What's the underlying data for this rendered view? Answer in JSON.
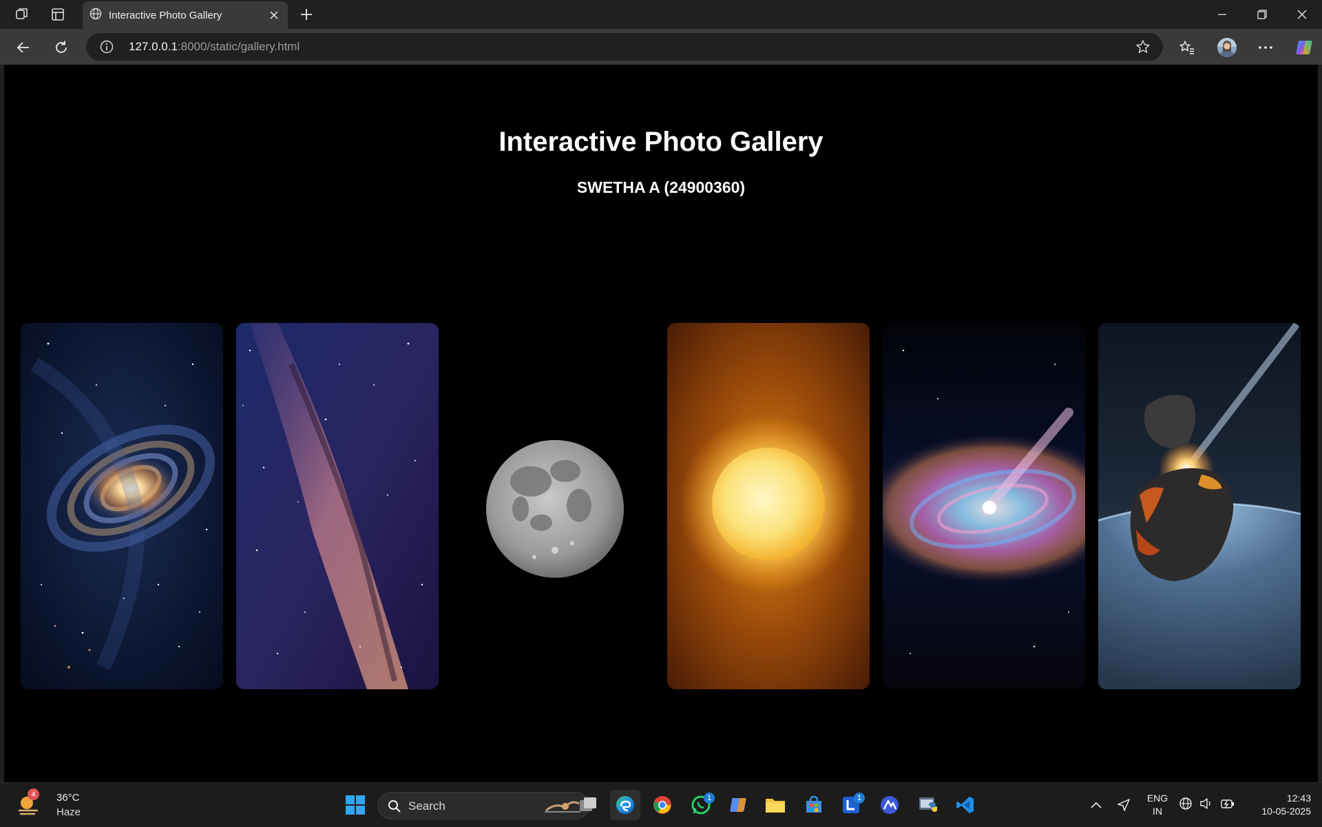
{
  "browser": {
    "tab_title": "Interactive Photo Gallery",
    "url_host": "127.0.0.1",
    "url_rest": ":8000/static/gallery.html"
  },
  "page": {
    "title": "Interactive Photo Gallery",
    "subtitle": "SWETHA A (24900360)",
    "images": [
      {
        "name": "spiral-galaxy-image"
      },
      {
        "name": "milky-way-image"
      },
      {
        "name": "moon-image"
      },
      {
        "name": "sun-image"
      },
      {
        "name": "galaxy-comet-image"
      },
      {
        "name": "asteroid-image"
      }
    ]
  },
  "taskbar": {
    "weather": {
      "temp": "36°C",
      "condition": "Haze",
      "badge": "4"
    },
    "search_label": "Search",
    "whatsapp_badge": "1",
    "launcher_badge": "1",
    "lang_top": "ENG",
    "lang_bottom": "IN",
    "time": "12:43",
    "date": "10-05-2025"
  }
}
